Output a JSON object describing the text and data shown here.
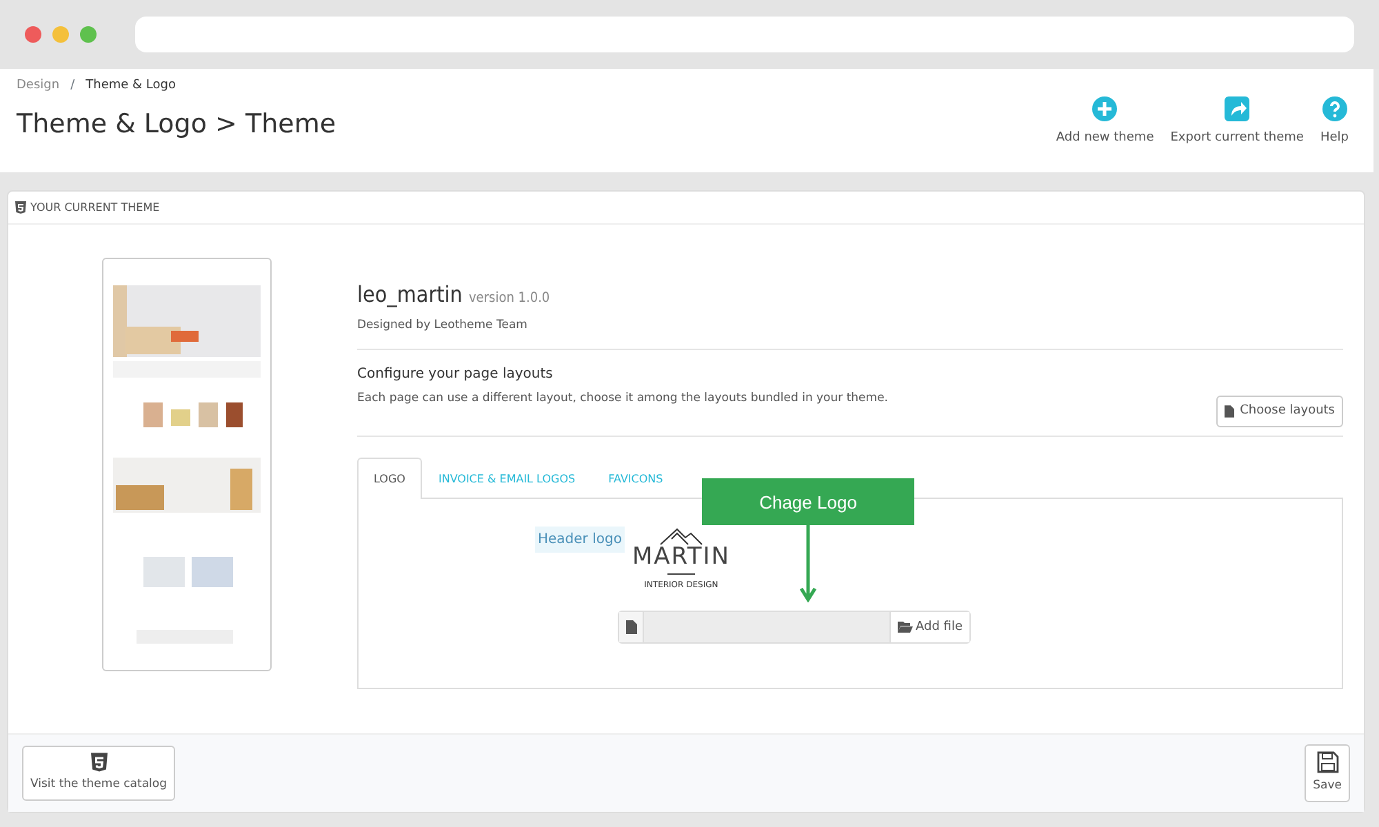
{
  "breadcrumb": [
    "Design",
    "Theme & Logo"
  ],
  "breadcrumb_separator": "/",
  "page_title": "Theme & Logo > Theme",
  "toolbar": [
    {
      "kind": "add",
      "label": "Add new theme"
    },
    {
      "kind": "export",
      "label": "Export current theme"
    },
    {
      "kind": "help",
      "label": "Help"
    }
  ],
  "panel": {
    "heading": "YOUR CURRENT THEME",
    "theme": {
      "name": "leo_martin",
      "version": "version 1.0.0",
      "author": "Designed by Leotheme Team"
    },
    "layouts": {
      "title": "Configure your page layouts",
      "description": "Each page can use a different layout, choose it among the layouts bundled in your theme.",
      "button": "Choose layouts"
    },
    "tabs": [
      {
        "label": "LOGO",
        "selected": true
      },
      {
        "label": "INVOICE & EMAIL LOGOS",
        "selected": false
      },
      {
        "label": "FAVICONS",
        "selected": false
      }
    ],
    "logo_field": {
      "label": "Header logo",
      "logo_name": "MARTIN",
      "logo_tagline": "INTERIOR DESIGN",
      "button": "Add file"
    },
    "callout": "Chage Logo",
    "footer": {
      "catalog_button": "Visit the theme catalog",
      "save_button": "Save"
    }
  }
}
